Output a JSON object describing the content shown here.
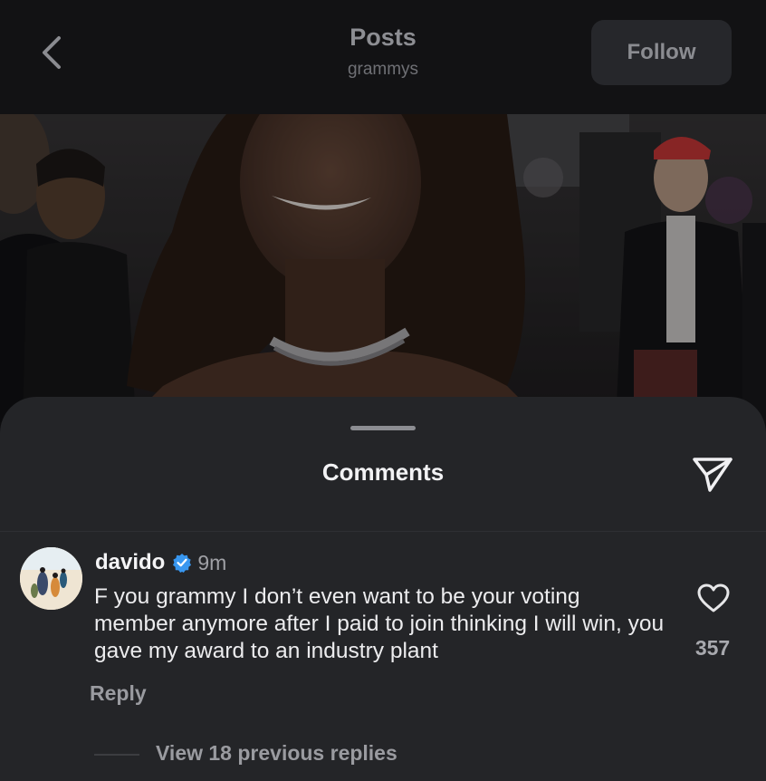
{
  "header": {
    "title": "Posts",
    "subtitle": "grammys",
    "follow_label": "Follow"
  },
  "comments_sheet": {
    "title": "Comments",
    "comment": {
      "username": "davido",
      "verified": true,
      "time": "9m",
      "text": "F you grammy I don’t even want to be your voting member anymore after I paid to join thinking I will win, you gave my award to an industry plant",
      "reply_label": "Reply",
      "like_count": "357",
      "view_replies_label": "View 18 previous replies"
    }
  },
  "icons": {
    "back": "chevron-left-icon",
    "share": "paper-plane-icon",
    "verified": "verified-badge-icon",
    "like": "heart-icon"
  },
  "colors": {
    "verified_blue": "#3897f0",
    "sheet_background": "#242528",
    "header_background": "#121214"
  }
}
